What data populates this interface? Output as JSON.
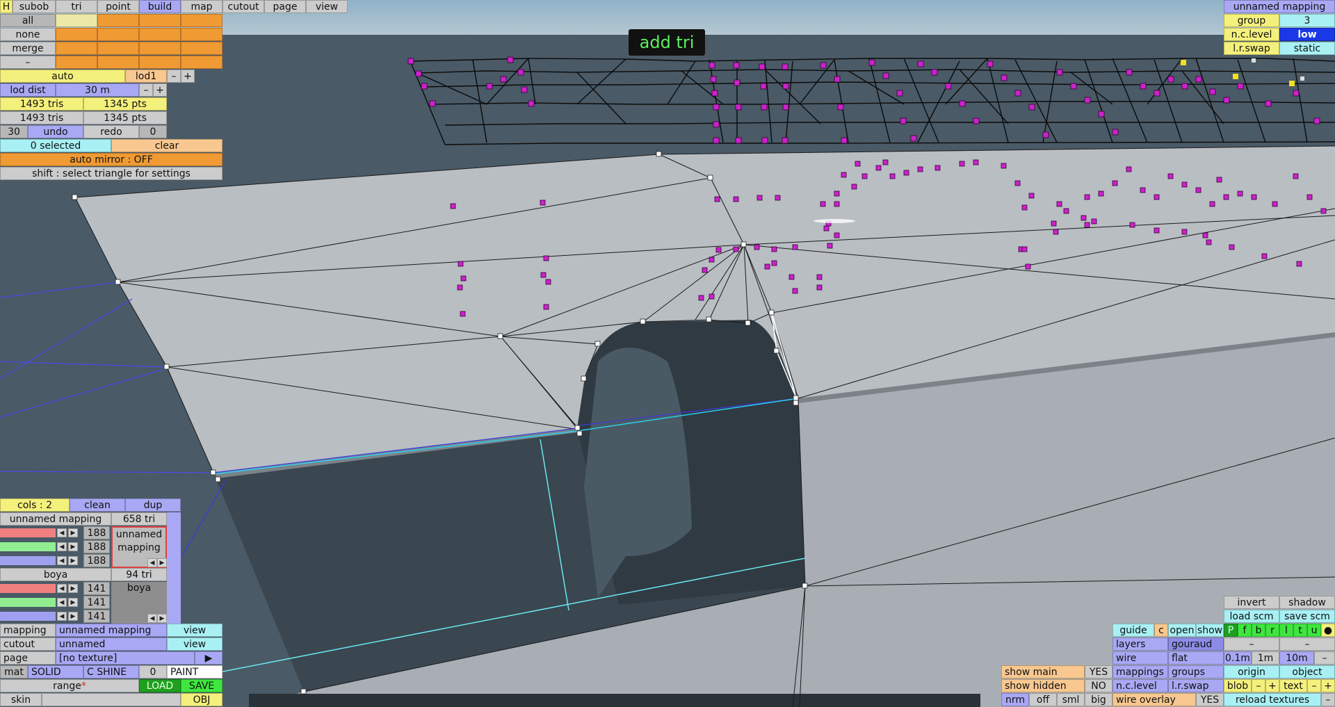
{
  "toast": "add tri",
  "tabs": {
    "h": "H",
    "subob": "subob",
    "tri": "tri",
    "point": "point",
    "build": "build",
    "map": "map",
    "cutout": "cutout",
    "page": "page",
    "view": "view"
  },
  "sel": {
    "all": "all",
    "none": "none",
    "merge": "merge",
    "dash": "–"
  },
  "lod": {
    "auto": "auto",
    "lod1": "lod1",
    "minus": "–",
    "plus": "+",
    "dist_label": "lod dist",
    "dist_value": "30 m"
  },
  "counts": {
    "tris1": "1493 tris",
    "pts1": "1345 pts",
    "tris2": "1493 tris",
    "pts2": "1345 pts"
  },
  "undo": {
    "n": "30",
    "undo": "undo",
    "redo": "redo",
    "redo_n": "0"
  },
  "selection": {
    "selected": "0 selected",
    "clear": "clear",
    "mirror": "auto mirror : OFF",
    "hint": "shift : select triangle for settings"
  },
  "topright": {
    "title": "unnamed mapping",
    "group_label": "group",
    "group_value": "3",
    "nclevel_label": "n.c.level",
    "nclevel_value": "low",
    "lrswap_label": "l.r.swap",
    "lrswap_value": "static"
  },
  "cols": {
    "label": "cols : 2",
    "clean": "clean",
    "dup": "dup"
  },
  "mat1": {
    "name": "unnamed mapping",
    "tris": "658 tri",
    "r": "188",
    "g": "188",
    "b": "188",
    "preview": "unnamed mapping"
  },
  "mat2": {
    "name": "boya",
    "tris": "94 tri",
    "r": "141",
    "g": "141",
    "b": "141",
    "preview": "boya"
  },
  "props": {
    "mapping_label": "mapping",
    "mapping_value": "unnamed mapping",
    "mapping_view": "view",
    "cutout_label": "cutout",
    "cutout_value": "unnamed",
    "cutout_view": "view",
    "page_label": "page",
    "page_value": "[no texture]",
    "page_arrow": "▶",
    "mat_label": "mat",
    "solid": "SOLID",
    "cshine": "C SHINE",
    "cshine_value": "0",
    "paint": "PAINT",
    "range": "range",
    "range_star": "*",
    "load": "LOAD",
    "save": "SAVE",
    "skin": "skin",
    "obj": "OBJ"
  },
  "br": {
    "invert": "invert",
    "shadow": "shadow",
    "load_scm": "load scm",
    "save_scm": "save scm",
    "guide": "guide",
    "c": "c",
    "open": "open",
    "show": "show",
    "letters": [
      "P",
      "f",
      "b",
      "r",
      "l",
      "t",
      "u",
      "●"
    ],
    "layers": "layers",
    "gouraud": "gouraud",
    "dash": "–",
    "wire": "wire",
    "flat": "flat",
    "s01": "0.1m",
    "s1": "1m",
    "s10": "10m",
    "mappings": "mappings",
    "groups": "groups",
    "origin": "origin",
    "object": "object",
    "show_main": "show main",
    "show_main_v": "YES",
    "show_hidden": "show hidden",
    "show_hidden_v": "NO",
    "nclevel": "n.c.level",
    "lrswap": "l.r.swap",
    "blob": "blob",
    "minus": "–",
    "plus": "+",
    "text": "text",
    "nrm": "nrm",
    "off": "off",
    "sml": "sml",
    "big": "big",
    "wire_overlay": "wire overlay",
    "wire_overlay_v": "YES",
    "reload": "reload textures"
  },
  "colors": {
    "magenta": "#cc22cc",
    "accent_blue": "#1a38e6"
  }
}
